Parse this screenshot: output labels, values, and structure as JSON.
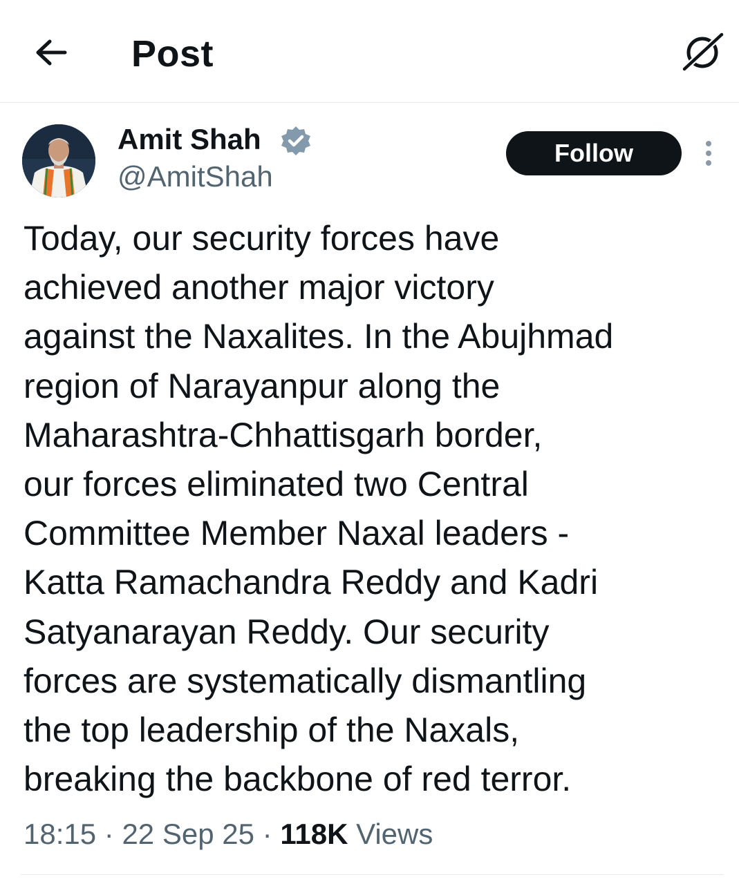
{
  "header": {
    "title": "Post",
    "back_icon": "arrow-left-icon",
    "grok_icon": "grok-icon"
  },
  "post": {
    "author": {
      "display_name": "Amit Shah",
      "handle": "@AmitShah",
      "verified": true,
      "verified_color": "#829aab"
    },
    "follow_label": "Follow",
    "more_icon": "more-vertical-icon",
    "text": "Today, our security forces have\nachieved another major victory\nagainst the Naxalites. In the Abujhmad\nregion of Narayanpur along the\nMaharashtra-Chhattisgarh border,\nour forces eliminated two Central\nCommittee Member Naxal leaders -\nKatta Ramachandra Reddy and Kadri\nSatyanarayan Reddy. Our security\nforces are systematically dismantling\nthe top leadership of the Naxals,\nbreaking the backbone of red terror.",
    "time": "18:15",
    "date": "22 Sep 25",
    "separator": "·",
    "views_count": "118K",
    "views_label": "Views"
  },
  "colors": {
    "text_primary": "#0f1419",
    "text_secondary": "#536471",
    "divider": "#e6e9ec",
    "button_bg": "#0f1419"
  }
}
